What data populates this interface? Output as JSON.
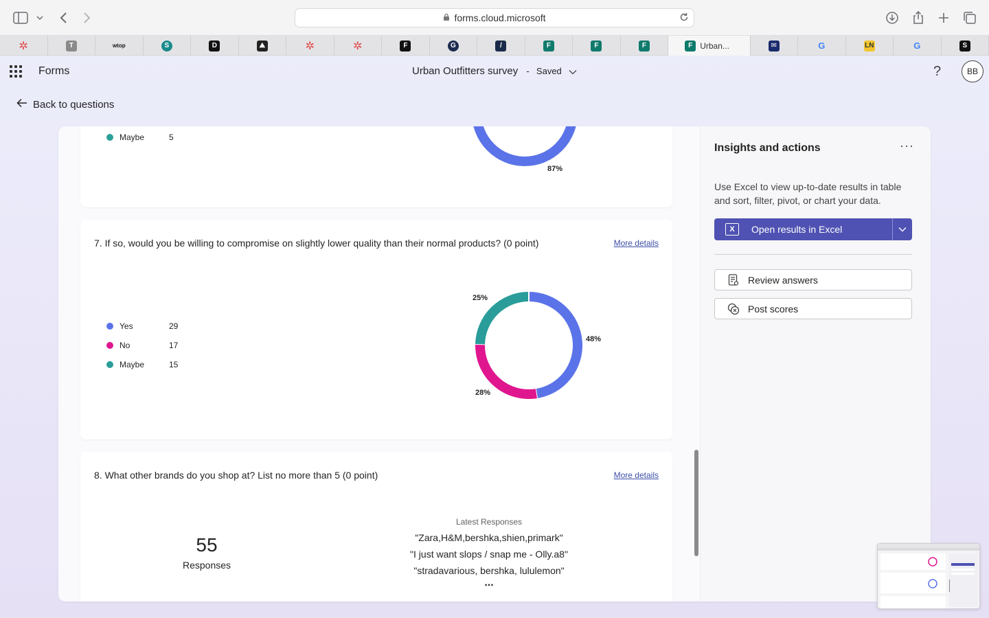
{
  "browser": {
    "url": "forms.cloud.microsoft",
    "active_tab_label": "Urban...",
    "tabs": [
      {
        "icon": "red-star-icon",
        "letter": "✲",
        "color": "#e34b4b"
      },
      {
        "icon": "t-icon",
        "letter": "T",
        "color": "#8a8a8a"
      },
      {
        "icon": "wtop-icon",
        "letter": "wtop",
        "color": "#ffffff"
      },
      {
        "icon": "sharepoint-icon",
        "letter": "S",
        "color": "#1a8b8c"
      },
      {
        "icon": "d-icon",
        "letter": "D",
        "color": "#111111"
      },
      {
        "icon": "mountain-icon",
        "letter": "⛰",
        "color": "#222222"
      },
      {
        "icon": "red-star-icon",
        "letter": "✲",
        "color": "#e34b4b"
      },
      {
        "icon": "red-star-icon",
        "letter": "✲",
        "color": "#e34b4b"
      },
      {
        "icon": "f-icon",
        "letter": "F",
        "color": "#111111"
      },
      {
        "icon": "g-circle-icon",
        "letter": "G",
        "color": "#1d2b4f"
      },
      {
        "icon": "stripe-icon",
        "letter": "/",
        "color": "#1a2a4a"
      },
      {
        "icon": "forms-icon",
        "letter": "F",
        "color": "#0f7b6c"
      },
      {
        "icon": "forms-icon",
        "letter": "F",
        "color": "#0f7b6c"
      },
      {
        "icon": "forms-icon",
        "letter": "F",
        "color": "#0f7b6c"
      },
      {
        "icon": "forms-icon",
        "letter": "F",
        "color": "#0f7b6c",
        "active": true
      },
      {
        "icon": "mail-icon",
        "letter": "✉",
        "color": "#1a2b6d"
      },
      {
        "icon": "google-icon",
        "letter": "G",
        "color": "#ffffff"
      },
      {
        "icon": "yellow-icon",
        "letter": "LN",
        "color": "#f2c530"
      },
      {
        "icon": "google-icon",
        "letter": "G",
        "color": "#ffffff"
      },
      {
        "icon": "s-icon",
        "letter": "S",
        "color": "#111111"
      }
    ]
  },
  "header": {
    "app_name": "Forms",
    "survey_title": "Urban Outfitters survey",
    "separator": "-",
    "status": "Saved",
    "help": "?",
    "avatar_initials": "BB"
  },
  "back_link": "Back to questions",
  "questions": {
    "q6_partial": {
      "legend": [
        {
          "label": "Maybe",
          "count": "5",
          "color": "#2aa198"
        }
      ],
      "pct_label": "87%"
    },
    "q7": {
      "title": "7. If so, would you be willing to compromise on slightly lower quality than their normal products? (0 point)",
      "more_details": "More details",
      "legend": [
        {
          "label": "Yes",
          "count": "29",
          "color": "#5b73e8"
        },
        {
          "label": "No",
          "count": "17",
          "color": "#e0168f"
        },
        {
          "label": "Maybe",
          "count": "15",
          "color": "#2a9d9a"
        }
      ],
      "pct_labels": {
        "yes": "48%",
        "no": "28%",
        "maybe": "25%"
      }
    },
    "q8": {
      "title": "8. What other brands do you shop at? List no more than 5 (0 point)",
      "more_details": "More details",
      "responses_count": "55",
      "responses_label": "Responses",
      "latest_title": "Latest Responses",
      "latest": [
        "\"Zara,H&M,bershka,shien,primark\"",
        "\"I just want slops / snap me - Olly.a8\"",
        "\"stradavarious, bershka, lululemon\""
      ],
      "ellipsis": "..."
    }
  },
  "chart_data": [
    {
      "type": "pie",
      "title": "7. If so, would you be willing to compromise on slightly lower quality than their normal products? (0 point)",
      "categories": [
        "Yes",
        "No",
        "Maybe"
      ],
      "values": [
        29,
        17,
        15
      ],
      "percent_labels": [
        "48%",
        "28%",
        "25%"
      ],
      "colors": [
        "#5b73e8",
        "#e0168f",
        "#2a9d9a"
      ],
      "legend": "left"
    }
  ],
  "insights": {
    "title": "Insights and actions",
    "more": "···",
    "description": "Use Excel to view up-to-date results in table and sort, filter, pivot, or chart your data.",
    "open_excel": "Open results in Excel",
    "review_answers": "Review answers",
    "post_scores": "Post scores"
  }
}
